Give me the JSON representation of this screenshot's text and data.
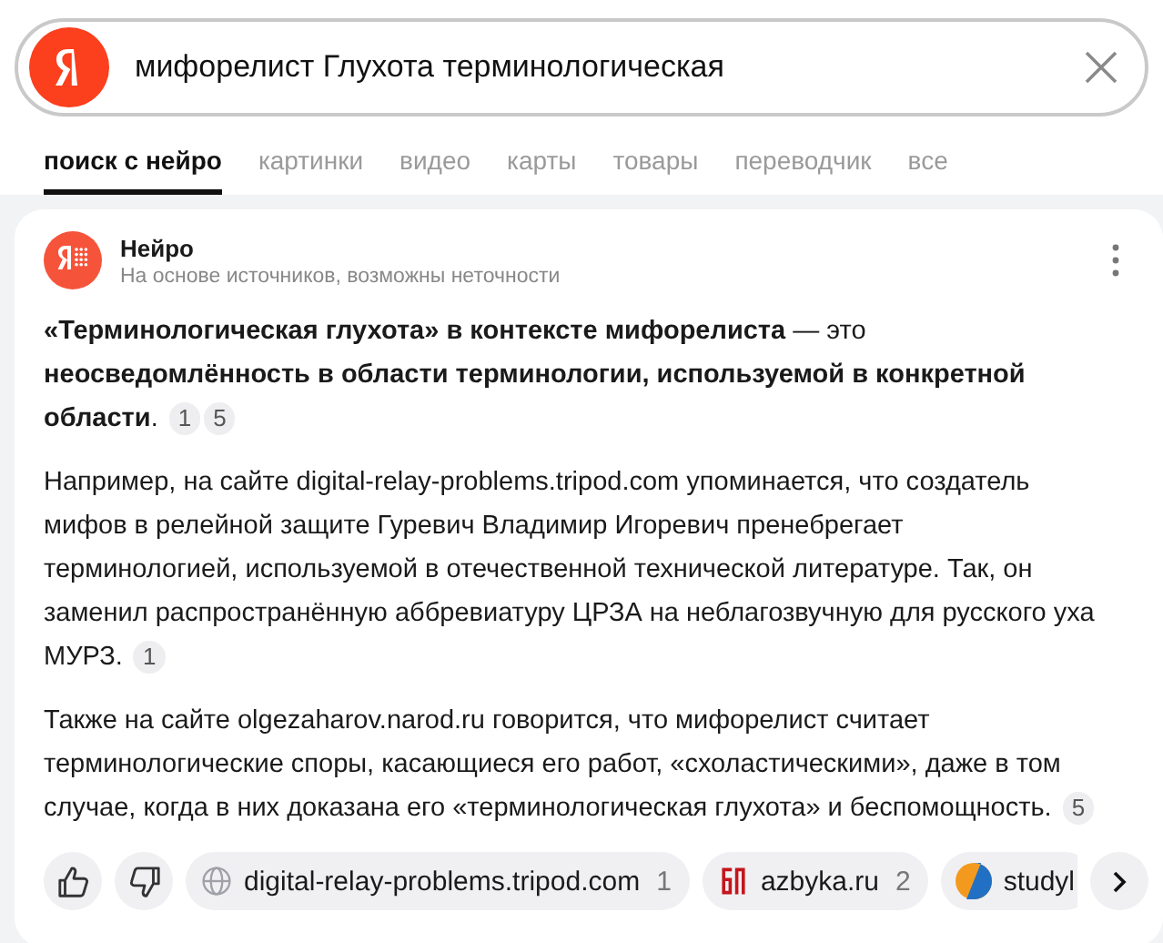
{
  "search": {
    "value": "мифорелист Глухота терминологическая"
  },
  "tabs": [
    {
      "label": "поиск с нейро",
      "selected": true
    },
    {
      "label": "картинки",
      "selected": false
    },
    {
      "label": "видео",
      "selected": false
    },
    {
      "label": "карты",
      "selected": false
    },
    {
      "label": "товары",
      "selected": false
    },
    {
      "label": "переводчик",
      "selected": false
    },
    {
      "label": "все",
      "selected": false
    }
  ],
  "answer": {
    "title": "Нейро",
    "subtitle": "На основе источников, возможны неточности",
    "paragraphs": [
      {
        "text": "**«Терминологическая глухота» в контексте мифорелиста** — это **неосведомлённость в области терминологии, используемой в конкретной области**.",
        "citations": [
          "1",
          "5"
        ]
      },
      {
        "text": "Например, на сайте digital-relay-problems.tripod.com упоминается, что создатель мифов в релейной защите Гуревич Владимир Игоревич пренебрегает терминологией, используемой в отечественной технической литературе. Так, он заменил распространённую аббревиатуру ЦРЗА на неблагозвучную для русского уха МУРЗ.",
        "citations": [
          "1"
        ]
      },
      {
        "text": "Также на сайте olgezaharov.narod.ru говорится, что мифорелист считает терминологические споры, касающиеся его работ, «схоластическими», даже в том случае, когда в них доказана его «терминологическая глухота» и беспомощность.",
        "citations": [
          "5"
        ]
      }
    ],
    "sources": [
      {
        "kind": "globe",
        "name": "digital-relay-problems.tripod.com",
        "number": "1"
      },
      {
        "kind": "azbyka",
        "name": "azbyka.ru",
        "number": "2"
      },
      {
        "kind": "studylib",
        "name": "studyl"
      }
    ]
  }
}
